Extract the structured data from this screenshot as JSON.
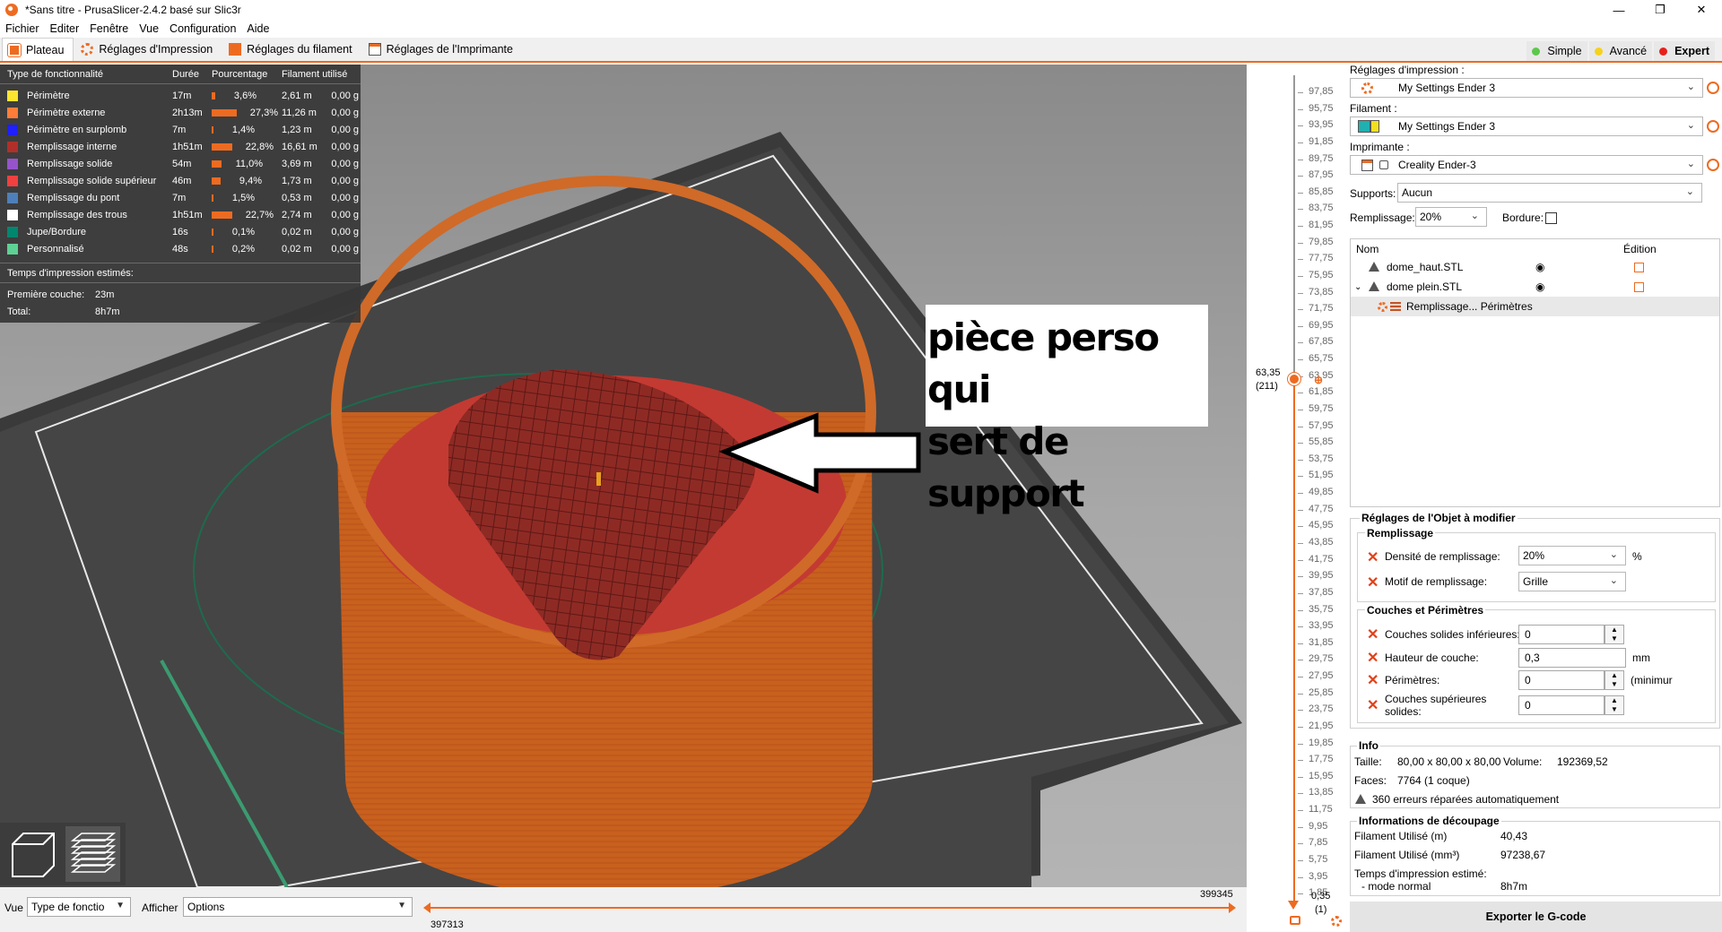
{
  "window": {
    "title": "*Sans titre - PrusaSlicer-2.4.2 basé sur Slic3r",
    "minimize": "—",
    "maximize": "❐",
    "close": "✕"
  },
  "menu": [
    "Fichier",
    "Editer",
    "Fenêtre",
    "Vue",
    "Configuration",
    "Aide"
  ],
  "tabs": [
    {
      "label": "Plateau",
      "active": true
    },
    {
      "label": "Réglages d'Impression",
      "active": false
    },
    {
      "label": "Réglages du filament",
      "active": false
    },
    {
      "label": "Réglages de l'Imprimante",
      "active": false
    }
  ],
  "modes": [
    {
      "label": "Simple",
      "color": "#5cc84a"
    },
    {
      "label": "Avancé",
      "color": "#f5d21c"
    },
    {
      "label": "Expert",
      "color": "#e8201c"
    }
  ],
  "legend": {
    "headers": [
      "Type de fonctionnalité",
      "Durée",
      "Pourcentage",
      "Filament utilisé"
    ],
    "rows": [
      {
        "name": "Périmètre",
        "color": "#ffe62e",
        "time": "17m",
        "pct": "3,6%",
        "pct_value": 3.6,
        "length": "2,61 m",
        "weight": "0,00 g"
      },
      {
        "name": "Périmètre externe",
        "color": "#ff7d38",
        "time": "2h13m",
        "pct": "27,3%",
        "pct_value": 27.3,
        "length": "11,26 m",
        "weight": "0,00 g"
      },
      {
        "name": "Périmètre en surplomb",
        "color": "#1f1fff",
        "time": "7m",
        "pct": "1,4%",
        "pct_value": 1.4,
        "length": "1,23 m",
        "weight": "0,00 g"
      },
      {
        "name": "Remplissage interne",
        "color": "#b03029",
        "time": "1h51m",
        "pct": "22,8%",
        "pct_value": 22.8,
        "length": "16,61 m",
        "weight": "0,00 g"
      },
      {
        "name": "Remplissage solide",
        "color": "#9654cc",
        "time": "54m",
        "pct": "11,0%",
        "pct_value": 11.0,
        "length": "3,69 m",
        "weight": "0,00 g"
      },
      {
        "name": "Remplissage solide supérieur",
        "color": "#f04040",
        "time": "46m",
        "pct": "9,4%",
        "pct_value": 9.4,
        "length": "1,73 m",
        "weight": "0,00 g"
      },
      {
        "name": "Remplissage du pont",
        "color": "#4d80ba",
        "time": "7m",
        "pct": "1,5%",
        "pct_value": 1.5,
        "length": "0,53 m",
        "weight": "0,00 g"
      },
      {
        "name": "Remplissage des trous",
        "color": "#ffffff",
        "time": "1h51m",
        "pct": "22,7%",
        "pct_value": 22.7,
        "length": "2,74 m",
        "weight": "0,00 g"
      },
      {
        "name": "Jupe/Bordure",
        "color": "#00876e",
        "time": "16s",
        "pct": "0,1%",
        "pct_value": 0.1,
        "length": "0,02 m",
        "weight": "0,00 g"
      },
      {
        "name": "Personnalisé",
        "color": "#5ed194",
        "time": "48s",
        "pct": "0,2%",
        "pct_value": 0.2,
        "length": "0,02 m",
        "weight": "0,00 g"
      }
    ],
    "estimates_label": "Temps d'impression estimés:",
    "first_layer_label": "Première couche:",
    "first_layer_value": "23m",
    "total_label": "Total:",
    "total_value": "8h7m"
  },
  "annotation": {
    "line1": "pièce perso qui",
    "line2": "sert de support"
  },
  "vertical_slider": {
    "ticks": [
      "97,85",
      "95,75",
      "93,95",
      "91,85",
      "89,75",
      "87,95",
      "85,85",
      "83,75",
      "81,95",
      "79,85",
      "77,75",
      "75,95",
      "73,85",
      "71,75",
      "69,95",
      "67,85",
      "65,75",
      "63,95",
      "61,85",
      "59,75",
      "57,95",
      "55,85",
      "53,75",
      "51,95",
      "49,85",
      "47,75",
      "45,95",
      "43,85",
      "41,75",
      "39,95",
      "37,85",
      "35,75",
      "33,95",
      "31,85",
      "29,75",
      "27,95",
      "25,85",
      "23,75",
      "21,95",
      "19,85",
      "17,75",
      "15,95",
      "13,85",
      "11,75",
      "9,95",
      "7,85",
      "5,75",
      "3,95",
      "1,85"
    ],
    "upper_value": "63,35",
    "upper_layer": "(211)",
    "lower_value": "0,35",
    "lower_layer": "(1)"
  },
  "bottom": {
    "view_label": "Vue",
    "view_value": "Type de fonctio",
    "show_label": "Afficher",
    "show_value": "Options",
    "h_upper": "399345",
    "h_lower": "397313"
  },
  "sidebar": {
    "print_settings_label": "Réglages d'impression :",
    "print_settings_value": "My Settings Ender 3",
    "filament_label": "Filament :",
    "filament_value": "My Settings Ender 3",
    "printer_label": "Imprimante :",
    "printer_value": "Creality Ender-3",
    "supports_label": "Supports:",
    "supports_value": "Aucun",
    "infill_label": "Remplissage:",
    "infill_value": "20%",
    "brim_label": "Bordure:",
    "objects": {
      "col_name": "Nom",
      "col_edit": "Édition",
      "items": [
        {
          "name": "dome_haut.STL"
        },
        {
          "name": "dome plein.STL"
        },
        {
          "name": "Remplissage... Périmètres"
        }
      ]
    },
    "object_settings": {
      "title": "Réglages de l'Objet à modifier",
      "infill_group": "Remplissage",
      "density_label": "Densité de remplissage:",
      "density_value": "20%",
      "density_unit": "%",
      "pattern_label": "Motif de remplissage:",
      "pattern_value": "Grille",
      "layers_group": "Couches et Périmètres",
      "bottom_layers_label": "Couches solides inférieures:",
      "bottom_layers_value": "0",
      "layer_height_label": "Hauteur de couche:",
      "layer_height_value": "0,3",
      "layer_height_unit": "mm",
      "perimeters_label": "Périmètres:",
      "perimeters_value": "0",
      "perimeters_unit": "(minimur",
      "top_layers_label_1": "Couches supérieures",
      "top_layers_label_2": "solides:",
      "top_layers_value": "0"
    },
    "info": {
      "title": "Info",
      "size_label": "Taille:",
      "size_value": "80,00 x 80,00 x 80,00",
      "volume_label": "Volume:",
      "volume_value": "192369,52",
      "faces_label": "Faces:",
      "faces_value": "7764 (1 coque)",
      "errors": "360 erreurs réparées automatiquement"
    },
    "slice_info": {
      "title": "Informations de découpage",
      "filament_m_label": "Filament Utilisé (m)",
      "filament_m_value": "40,43",
      "filament_mm3_label": "Filament Utilisé (mm³)",
      "filament_mm3_value": "97238,67",
      "time_label": "Temps d'impression estimé:",
      "mode_label": "- mode normal",
      "mode_value": "8h7m"
    },
    "export_label": "Exporter le G-code"
  },
  "colors": {
    "accent": "#ed6b21",
    "bed": "#3a3a3a",
    "object": "#c8601e",
    "infill": "#a02828"
  }
}
